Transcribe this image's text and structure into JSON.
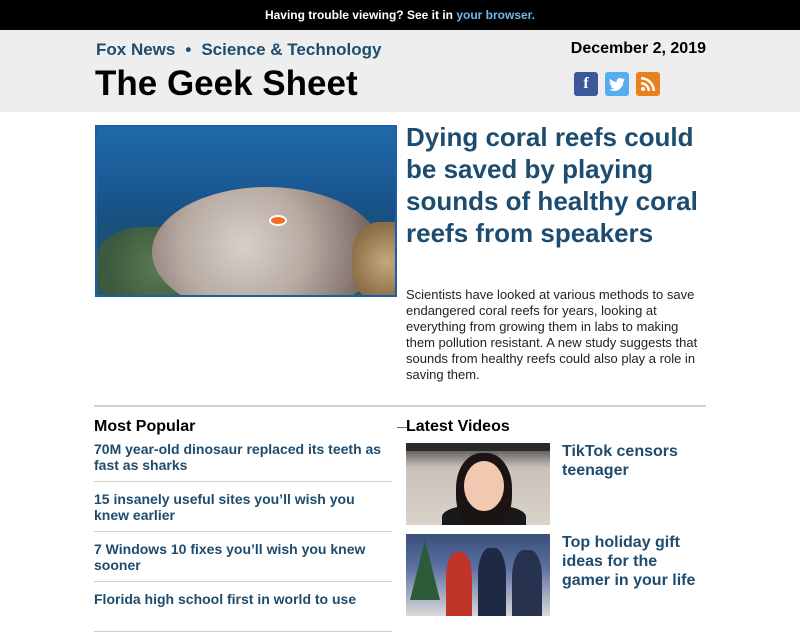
{
  "topbar": {
    "text": "Having trouble viewing? See it in ",
    "link": "your browser."
  },
  "header": {
    "brand": "Fox News",
    "section": "Science & Technology",
    "separator": "•",
    "masthead": "The Geek Sheet",
    "date": "December 2, 2019",
    "social": [
      "facebook-icon",
      "twitter-icon",
      "rss-icon"
    ]
  },
  "hero": {
    "headline": "Dying coral reefs could be saved by playing sounds of healthy coral reefs from speakers",
    "summary": "Scientists have looked at various methods to save endangered coral reefs for years, looking at everything from growing them in labs to making them pollution resistant. A new study suggests that sounds from healthy reefs could also play a role in saving them."
  },
  "most_popular": {
    "title": "Most Popular",
    "items": [
      "70M year-old dinosaur replaced its teeth as fast as sharks",
      "15 insanely useful sites you’ll wish you knew earlier",
      "7 Windows 10 fixes you’ll wish you knew sooner",
      "Florida high school first in world to use"
    ]
  },
  "latest_videos": {
    "title": "Latest Videos",
    "items": [
      "TikTok censors teenager",
      "Top holiday gift ideas for the gamer in your life"
    ]
  },
  "colors": {
    "accent": "#1e4c6e",
    "link": "#6fb8e8"
  }
}
